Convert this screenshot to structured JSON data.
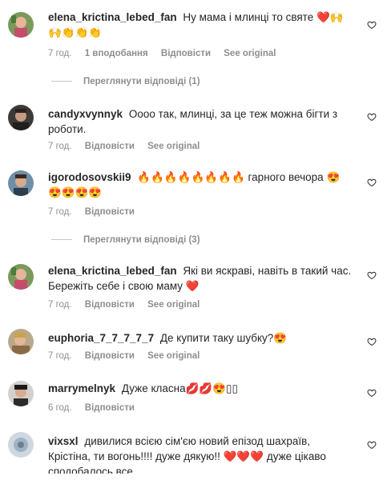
{
  "comments": [
    {
      "username": "elena_krictina_lebed_fan",
      "text": "Ну мама і млинці то святе",
      "emoji_tail": "❤️🙌🙌👏👏👏",
      "time": "7 год.",
      "likes": "1 вподобання",
      "reply": "Відповісти",
      "see_original": "See original",
      "view_replies": "Переглянути відповіді (1)"
    },
    {
      "username": "candyxvynnyk",
      "text": "Оооо так, млинці, за це теж можна бігти з роботи.",
      "time": "7 год.",
      "reply": "Відповісти",
      "see_original": "See original"
    },
    {
      "username": "igorodosovskii9",
      "text_before": "🔥🔥🔥🔥🔥🔥🔥🔥",
      "text": "гарного вечора",
      "emoji_tail": "😍😍😍😍😍",
      "time": "7 год.",
      "reply": "Відповісти",
      "view_replies": "Переглянути відповіді (3)"
    },
    {
      "username": "elena_krictina_lebed_fan",
      "text": "Які ви яскраві, навіть в такий час. Бережіть себе і свою маму",
      "emoji_tail": "❤️",
      "time": "7 год.",
      "reply": "Відповісти",
      "see_original": "See original"
    },
    {
      "username": "euphoria_7_7_7_7_7",
      "text": "Де купити таку шубку?",
      "emoji_tail": "😍",
      "time": "7 год.",
      "reply": "Відповісти",
      "see_original": "See original"
    },
    {
      "username": "marrymelnyk",
      "text": "Дуже класна",
      "emoji_tail": "💋💋😍▯▯",
      "time": "6 год.",
      "reply": "Відповісти"
    },
    {
      "username": "vixsxl",
      "text": "дивилися всією сім'єю новий епізод шахраїв, Крістіна, ти вогонь!!!! дуже дякую!!",
      "emoji_tail": "❤️❤️❤️",
      "text_after": "дуже цікаво сподобалось все"
    }
  ],
  "colors": {
    "text": "#262626",
    "meta": "#8e8e8e",
    "heart_red": "#e0245e",
    "divider": "#c7c7c7"
  },
  "icons": {
    "like": "heart-outline-icon"
  }
}
